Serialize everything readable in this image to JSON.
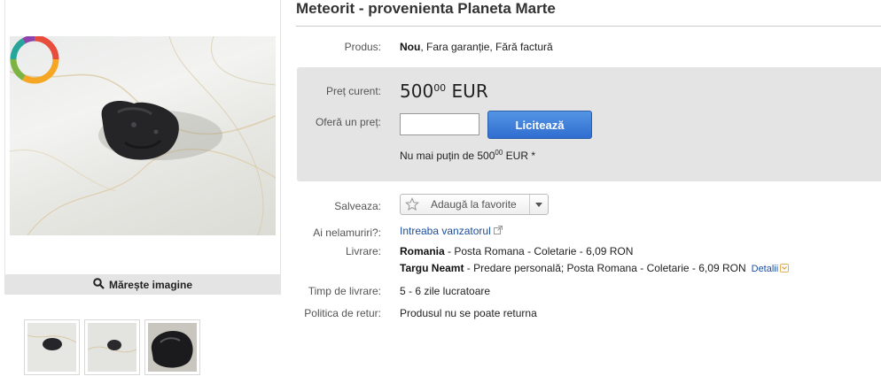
{
  "listing": {
    "title": "Meteorit - provenienta Planeta Marte"
  },
  "gallery": {
    "zoom_label": "Mărește imagine",
    "thumbnail_count": 3
  },
  "product": {
    "label": "Produs:",
    "condition": "Nou",
    "rest": ", Fara garanție, Fără factură"
  },
  "price": {
    "label": "Preț curent:",
    "whole": "500",
    "cents": "00",
    "currency": "EUR"
  },
  "offer": {
    "label": "Oferă un preț:",
    "input_value": "",
    "button_label": "Licitează",
    "min_prefix": "Nu mai puțin de 500",
    "min_cents": "00",
    "min_suffix": " EUR *"
  },
  "save": {
    "label": "Salveaza:",
    "button_label": "Adaugă la favorite"
  },
  "questions": {
    "label": "Ai nelamuriri?:",
    "link": "Intreaba vanzatorul"
  },
  "delivery": {
    "label": "Livrare:",
    "line1_place": "Romania",
    "line1_rest": " - Posta Romana - Coletarie - 6,09 RON",
    "line2_place": "Targu Neamt",
    "line2_rest": " - Predare personală; Posta Romana - Coletarie - 6,09 RON",
    "details_link": "Detalii"
  },
  "delivery_time": {
    "label": "Timp de livrare:",
    "value": "5 - 6 zile lucratoare"
  },
  "returns": {
    "label": "Politica de retur:",
    "value": "Produsul nu se poate returna"
  },
  "colors": {
    "accent_blue": "#2f6ed0",
    "bid_panel": "#e4e4e4",
    "link": "#1b4fa0"
  }
}
